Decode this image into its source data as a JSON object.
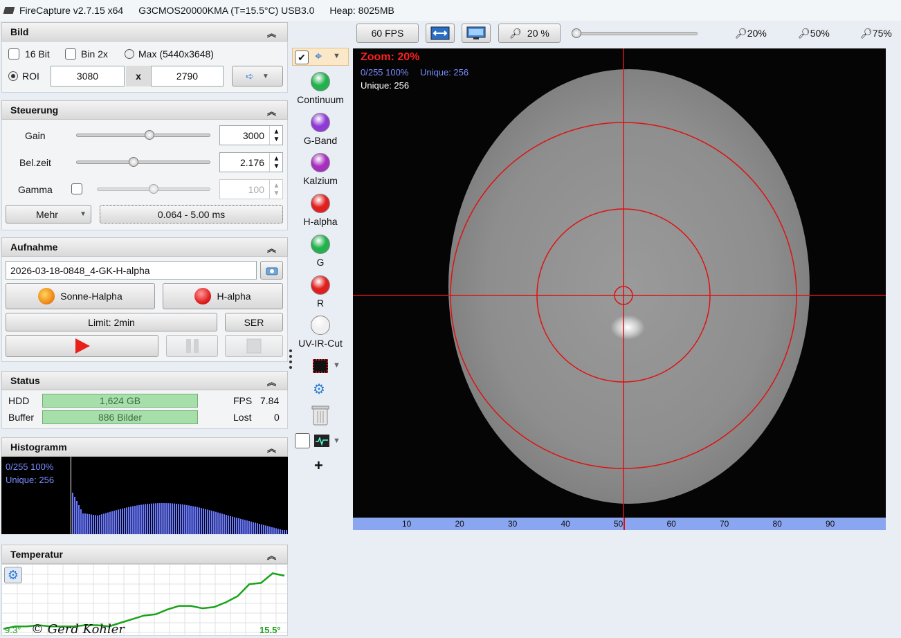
{
  "window": {
    "app_title": "FireCapture v2.7.15 x64",
    "camera": "G3CMOS20000KMA (T=15.5°C) USB3.0",
    "heap": "Heap: 8025MB"
  },
  "bild": {
    "title": "Bild",
    "bit16_label": "16 Bit",
    "bin2x_label": "Bin 2x",
    "max_label": "Max (5440x3648)",
    "roi_label": "ROI",
    "roi_width": "3080",
    "roi_x": "x",
    "roi_height": "2790"
  },
  "steuerung": {
    "title": "Steuerung",
    "gain_label": "Gain",
    "gain_value": "3000",
    "gain_level": 0.55,
    "exposure_label": "Bel.zeit",
    "exposure_value": "2.176",
    "exposure_level": 0.42,
    "gamma_label": "Gamma",
    "gamma_value": "100",
    "gamma_level": 0.5,
    "more_label": "Mehr",
    "range_label": "0.064 - 5.00 ms"
  },
  "aufnahme": {
    "title": "Aufnahme",
    "filename": "2026-03-18-0848_4-GK-H-alpha",
    "profile_label": "Sonne-Halpha",
    "filter_label": "H-alpha",
    "limit_label": "Limit: 2min",
    "format_label": "SER"
  },
  "status": {
    "title": "Status",
    "hdd_label": "HDD",
    "hdd_value": "1,624 GB",
    "buffer_label": "Buffer",
    "buffer_value": "886 Bilder",
    "fps_label": "FPS",
    "fps_value": "7.84",
    "lost_label": "Lost",
    "lost_value": "0"
  },
  "histogramm": {
    "title": "Histogramm",
    "range_text": "0/255 100%",
    "unique_text": "Unique: 256"
  },
  "temperatur": {
    "title": "Temperatur",
    "min_label": "9.3°",
    "max_label": "15.5°",
    "copyright": "© Gerd Kohler",
    "series": [
      9.3,
      9.5,
      9.5,
      9.6,
      9.5,
      9.5,
      9.5,
      9.6,
      9.6,
      9.5,
      9.8,
      10.1,
      10.4,
      10.5,
      10.9,
      11.2,
      11.2,
      11.0,
      11.1,
      11.5,
      12.0,
      13.0,
      13.1,
      13.9,
      13.7
    ]
  },
  "toolbar": {
    "fps_button": "60 FPS",
    "zoom_button": "20 %",
    "zoom_20": "20%",
    "zoom_50": "50%",
    "zoom_75": "75%"
  },
  "filters": [
    {
      "label": "Continuum",
      "color": "#22b14c"
    },
    {
      "label": "G-Band",
      "color": "#8f3ad6"
    },
    {
      "label": "Kalzium",
      "color": "#a62fc0"
    },
    {
      "label": "H-alpha",
      "color": "#e0201f"
    },
    {
      "label": "G",
      "color": "#22b14c"
    },
    {
      "label": "R",
      "color": "#e0201f"
    },
    {
      "label": "UV-IR-Cut",
      "color": "#f0f0f0"
    }
  ],
  "preview": {
    "zoom_text": "Zoom: 20%",
    "range_text": "0/255 100%",
    "unique_blue": "Unique: 256",
    "unique_white": "Unique: 256",
    "ruler": [
      "10",
      "20",
      "30",
      "40",
      "50",
      "60",
      "70",
      "80",
      "90"
    ]
  },
  "colors": {
    "crosshair": "#e01010",
    "ruler_bg": "#8aa6f0",
    "histogram_bar": "#6b79ff",
    "temp_line": "#1aa31a"
  }
}
